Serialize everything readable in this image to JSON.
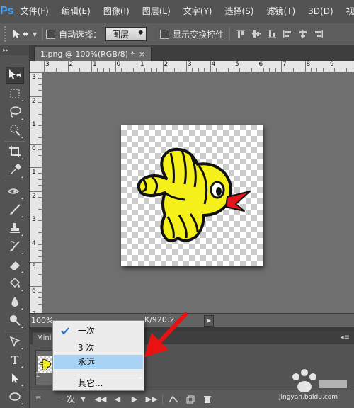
{
  "app": {
    "logo": "Ps"
  },
  "menu": [
    "文件(F)",
    "编辑(E)",
    "图像(I)",
    "图层(L)",
    "文字(Y)",
    "选择(S)",
    "滤镜(T)",
    "3D(D)",
    "视"
  ],
  "options": {
    "auto_select_label": "自动选择：",
    "auto_select_checked": false,
    "layer_select_value": "图层",
    "show_transform_label": "显示变换控件",
    "show_transform_checked": false
  },
  "document": {
    "tab_title": "1.png @ 100%(RGB/8) *",
    "tab_close": "×"
  },
  "rulers": {
    "top_labels": [
      "3",
      "2",
      "1",
      "0",
      "1",
      "2",
      "3",
      "4",
      "5",
      "6",
      "7",
      "8",
      "9",
      "10"
    ],
    "left_labels": [
      "3",
      "2",
      "1",
      "0",
      "1",
      "2",
      "3",
      "4",
      "5",
      "6",
      "7",
      "8"
    ]
  },
  "status": {
    "zoom": "100%",
    "info": "K/920.2"
  },
  "panel": {
    "tab_label": "Mini",
    "frame_index": "1",
    "loop_value": "一次"
  },
  "loop_dropdown": {
    "options": [
      "一次",
      "3 次",
      "永远",
      "其它..."
    ],
    "checked_index": 0,
    "highlighted_index": 2
  },
  "colors": {
    "bird_body": "#f5ef1a",
    "bird_beak": "#e8141c",
    "annotation_arrow": "#e81212",
    "highlight": "#a9d3f5"
  },
  "watermark": {
    "text": "jingyan.baidu.com"
  }
}
